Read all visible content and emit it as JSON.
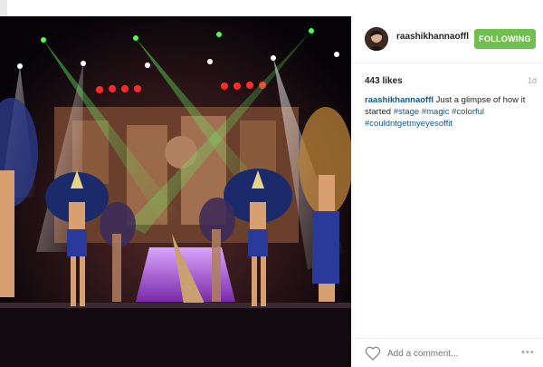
{
  "header": {
    "username": "raashikhannaoffl",
    "follow_label": "FOLLOWING",
    "follow_color": "#70c050"
  },
  "post": {
    "likes": "443 likes",
    "time": "1d",
    "caption_user": "raashikhannaoffl",
    "caption_text": " Just a glimpse of how it started ",
    "hashtags": [
      "#stage",
      "#magic",
      "#colorful",
      "#couldntgetmyeyesoffit"
    ]
  },
  "comment": {
    "placeholder": "Add a comment...",
    "heart_icon": "heart-icon",
    "more_icon": "more-options-icon",
    "more_label": "•••"
  },
  "colors": {
    "link": "#125688",
    "muted": "#a5a7aa"
  }
}
